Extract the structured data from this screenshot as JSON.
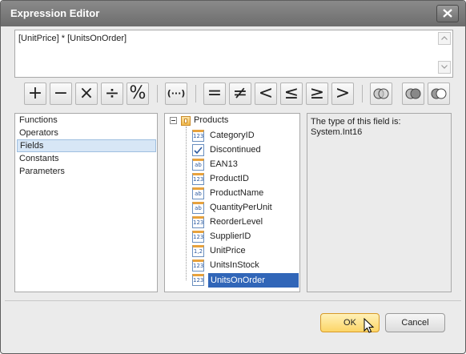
{
  "window": {
    "title": "Expression Editor"
  },
  "expression": {
    "text": "[UnitPrice] * [UnitsOnOrder]"
  },
  "operators": [
    {
      "label": "+",
      "name": "plus"
    },
    {
      "label": "−",
      "name": "minus"
    },
    {
      "label": "×",
      "name": "multiply"
    },
    {
      "label": "÷",
      "name": "divide"
    },
    {
      "label": "%",
      "name": "modulo"
    },
    {
      "label": "(···)",
      "name": "parentheses"
    },
    {
      "label": "=",
      "name": "equals"
    },
    {
      "label": "≠",
      "name": "not-equals"
    },
    {
      "label": "<",
      "name": "less-than"
    },
    {
      "label": "≤",
      "name": "less-or-equal"
    },
    {
      "label": "≥",
      "name": "greater-or-equal"
    },
    {
      "label": ">",
      "name": "greater-than"
    },
    {
      "icon": "venn-overlap-icon",
      "name": "logical-1"
    },
    {
      "icon": "venn-intersection-icon",
      "name": "logical-2"
    },
    {
      "icon": "venn-exclusive-icon",
      "name": "logical-3"
    }
  ],
  "categories": {
    "items": [
      "Functions",
      "Operators",
      "Fields",
      "Constants",
      "Parameters"
    ],
    "selected": "Fields"
  },
  "tree": {
    "root": "Products",
    "fields": [
      {
        "name": "CategoryID",
        "type_icon": "123"
      },
      {
        "name": "Discontinued",
        "type_icon": "check"
      },
      {
        "name": "EAN13",
        "type_icon": "ab"
      },
      {
        "name": "ProductID",
        "type_icon": "123"
      },
      {
        "name": "ProductName",
        "type_icon": "ab"
      },
      {
        "name": "QuantityPerUnit",
        "type_icon": "ab"
      },
      {
        "name": "ReorderLevel",
        "type_icon": "123"
      },
      {
        "name": "SupplierID",
        "type_icon": "123"
      },
      {
        "name": "UnitPrice",
        "type_icon": "1,2"
      },
      {
        "name": "UnitsInStock",
        "type_icon": "123"
      },
      {
        "name": "UnitsOnOrder",
        "type_icon": "123"
      }
    ],
    "selected": "UnitsOnOrder"
  },
  "description": {
    "line1": "The type of this field is:",
    "line2": "System.Int16"
  },
  "buttons": {
    "ok": "OK",
    "cancel": "Cancel"
  },
  "colors": {
    "selection": "#3166b8",
    "ok_accent": "#fcd567"
  }
}
